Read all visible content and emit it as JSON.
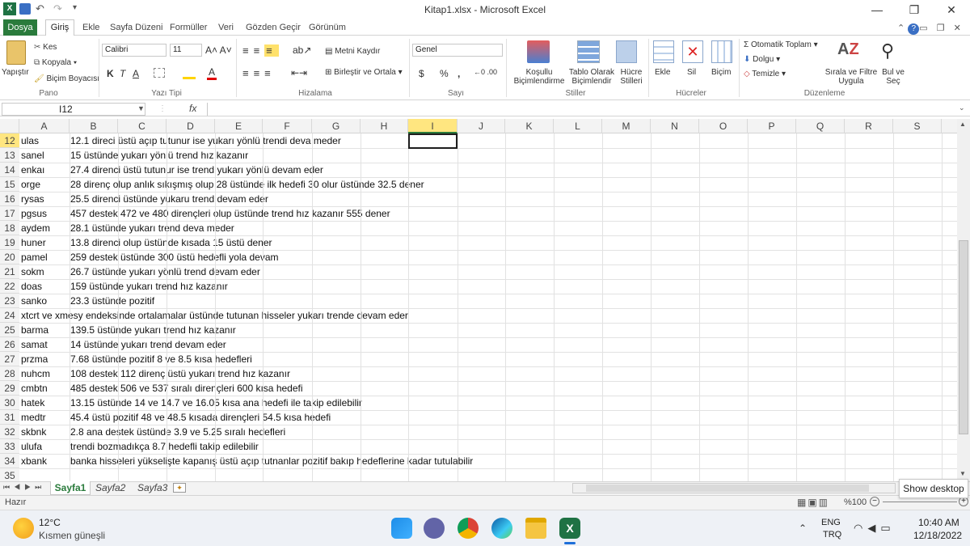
{
  "window": {
    "title": "Kitap1.xlsx - Microsoft Excel"
  },
  "ribbon_tabs": [
    "Dosya",
    "Giriş",
    "Ekle",
    "Sayfa Düzeni",
    "Formüller",
    "Veri",
    "Gözden Geçir",
    "Görünüm"
  ],
  "clipboard": {
    "paste": "Yapıştır",
    "cut": "Kes",
    "copy": "Kopyala",
    "format_painter": "Biçim Boyacısı",
    "label": "Pano"
  },
  "font": {
    "name": "Calibri",
    "size": "11",
    "label": "Yazı Tipi",
    "bold": "K",
    "italic": "T",
    "underline": "A"
  },
  "alignment": {
    "wrap": "Metni Kaydır",
    "merge": "Birleştir ve Ortala",
    "label": "Hizalama"
  },
  "number": {
    "format": "Genel",
    "currency": "$",
    "percent": "%",
    "comma": ",",
    "label": "Sayı"
  },
  "styles": {
    "conditional": "Koşullu Biçimlendirme",
    "table": "Tablo Olarak Biçimlendir",
    "cell": "Hücre Stilleri",
    "label": "Stiller"
  },
  "cells": {
    "insert": "Ekle",
    "delete": "Sil",
    "format": "Biçim",
    "label": "Hücreler"
  },
  "editing": {
    "autosum": "Otomatik Toplam",
    "fill": "Dolgu",
    "clear": "Temizle",
    "sort": "Sırala ve Filtre Uygula",
    "find": "Bul ve Seç",
    "label": "Düzenleme"
  },
  "formula_bar": {
    "name_box": "I12",
    "fx": "fx",
    "value": ""
  },
  "columns": [
    "A",
    "B",
    "C",
    "D",
    "E",
    "F",
    "G",
    "H",
    "I",
    "J",
    "K",
    "L",
    "M",
    "N",
    "O",
    "P",
    "Q",
    "R",
    "S"
  ],
  "rows": [
    {
      "n": "12",
      "a": "ulas",
      "b": "12.1 direci üstü açıp tutunur ise yukarı yönlü trendi deva meder"
    },
    {
      "n": "13",
      "a": "sanel",
      "b": "15 üstünde yukarı yönlü trend hız kazanır"
    },
    {
      "n": "14",
      "a": "enkaı",
      "b": "27.4 direnci üstü tutunur ise trend yukarı yönlü devam eder"
    },
    {
      "n": "15",
      "a": "orge",
      "b": "28 direnç olup anlık sıkışmış olup 28 üstünde ilk hedefi 30 olur üstünde 32.5 dener"
    },
    {
      "n": "16",
      "a": "rysas",
      "b": "25.5 direnci üstünde yukaru trend devam eder"
    },
    {
      "n": "17",
      "a": "pgsus",
      "b": "457 destek 472 ve 480 dirençleri olup üstünde trend hız kazanır 555 dener"
    },
    {
      "n": "18",
      "a": "aydem",
      "b": "28.1 üstünde yukarı trend deva meder"
    },
    {
      "n": "19",
      "a": "huner",
      "b": "13.8 direnci olup üstünde kısada 15 üstü dener"
    },
    {
      "n": "20",
      "a": "pamel",
      "b": "259 destek üstünde 300 üstü hedefli yola devam"
    },
    {
      "n": "21",
      "a": "sokm",
      "b": "26.7 üstünde yukarı yönlü trend devam eder"
    },
    {
      "n": "22",
      "a": "doas",
      "b": "159 üstünde yukarı trend hız kazanır"
    },
    {
      "n": "23",
      "a": "sanko",
      "b": "23.3 üstünde pozitif"
    },
    {
      "n": "24",
      "a": "xtcrt ve xmesy endeksinde ortalamalar üstünde tutunan hisseler yukarı trende devam eder",
      "b": ""
    },
    {
      "n": "25",
      "a": "barma",
      "b": "139.5 üstünde yukarı trend hız kazanır"
    },
    {
      "n": "26",
      "a": "samat",
      "b": "14 üstünde yukarı trend devam eder"
    },
    {
      "n": "27",
      "a": "przma",
      "b": "7.68 üstünde pozitif 8 ve 8.5 kısa hedefleri"
    },
    {
      "n": "28",
      "a": "nuhcm",
      "b": "108 destek 112 direnç üstü yukarı trend hız kazanır"
    },
    {
      "n": "29",
      "a": "cmbtn",
      "b": "485 destek 506 ve 537 sıralı dirençleri 600 kısa hedefi"
    },
    {
      "n": "30",
      "a": "hatek",
      "b": "13.15 üstünde 14 ve 14.7 ve 16.05 kısa ana hedefi ile takip edilebilir"
    },
    {
      "n": "31",
      "a": "medtr",
      "b": "45.4 üstü pozitif 48 ve 48.5 kısada dirençleri 54.5 kısa hedefi"
    },
    {
      "n": "32",
      "a": "skbnk",
      "b": "2.8 ana destek üstünde 3.9 ve 5.25 sıralı hedefleri"
    },
    {
      "n": "33",
      "a": "ulufa",
      "b": "trendi bozmadıkça 8.7 hedefli takip edilebilir"
    },
    {
      "n": "34",
      "a": "xbank",
      "b": "banka hisseleri yükselişte kapanış üstü açıp tutnanlar pozitif bakıp hedeflerine kadar tutulabilir"
    },
    {
      "n": "35",
      "a": "",
      "b": ""
    }
  ],
  "sheets": [
    "Sayfa1",
    "Sayfa2",
    "Sayfa3"
  ],
  "status": {
    "ready": "Hazır",
    "zoom": "%100",
    "show_desktop": "Show desktop"
  },
  "taskbar": {
    "temp": "12°C",
    "weather": "Kısmen güneşli",
    "lang1": "ENG",
    "lang2": "TRQ",
    "time": "10:40 AM",
    "date": "12/18/2022"
  }
}
